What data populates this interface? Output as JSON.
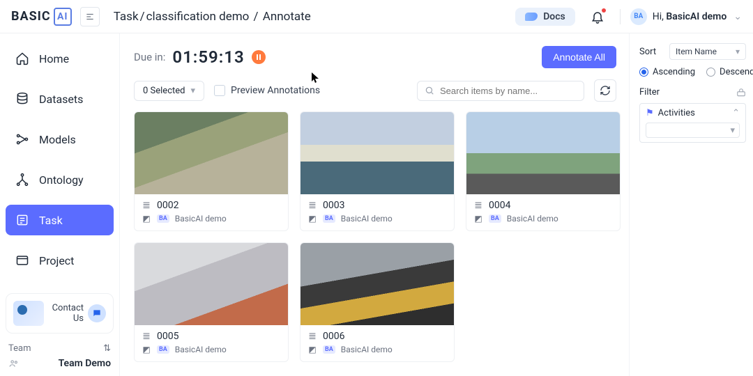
{
  "brand": {
    "name": "BASIC",
    "ai": "AI"
  },
  "breadcrumb": {
    "root": "Task",
    "project": "classification demo",
    "page": "Annotate"
  },
  "topbar": {
    "docs": "Docs",
    "greeting": "Hi, ",
    "username": "BasicAI demo",
    "avatar_initials": "BA"
  },
  "sidebar": {
    "items": [
      {
        "label": "Home"
      },
      {
        "label": "Datasets"
      },
      {
        "label": "Models"
      },
      {
        "label": "Ontology"
      },
      {
        "label": "Task"
      },
      {
        "label": "Project"
      }
    ],
    "active_index": 4,
    "contact": "Contact Us",
    "team_label": "Team",
    "team_name": "Team Demo"
  },
  "main": {
    "due_label": "Due in:",
    "countdown": "01:59:13",
    "annotate_all": "Annotate All",
    "selected_label": "0 Selected",
    "preview_label": "Preview Annotations",
    "search_placeholder": "Search items by name..."
  },
  "cards": [
    {
      "id": "0002",
      "owner": "BasicAI demo"
    },
    {
      "id": "0003",
      "owner": "BasicAI demo"
    },
    {
      "id": "0004",
      "owner": "BasicAI demo"
    },
    {
      "id": "0005",
      "owner": "BasicAI demo"
    },
    {
      "id": "0006",
      "owner": "BasicAI demo"
    }
  ],
  "rightpanel": {
    "sort_label": "Sort",
    "sort_value": "Item Name",
    "asc": "Ascending",
    "desc": "Descending",
    "order": "asc",
    "filter_label": "Filter",
    "activities_label": "Activities"
  }
}
